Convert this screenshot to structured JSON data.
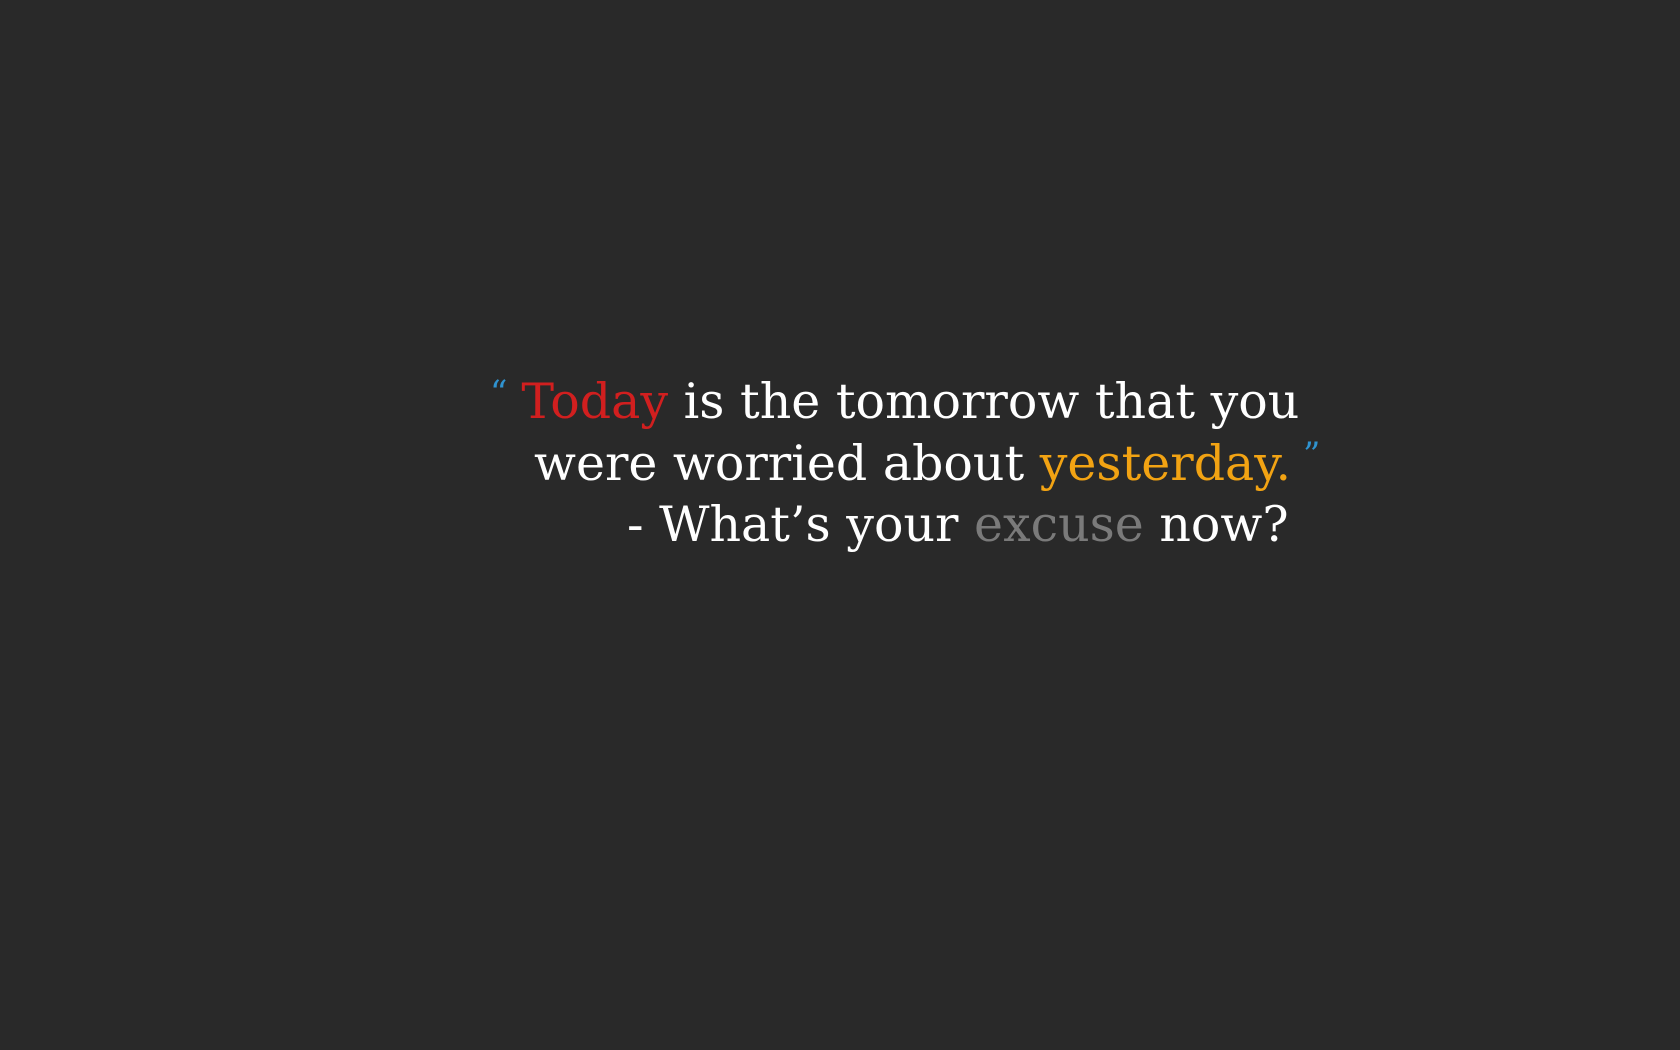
{
  "colors": {
    "background": "#292929",
    "text": "#ffffff",
    "quote_marks": "#2f93d0",
    "today": "#d11f1f",
    "yesterday": "#f2a313",
    "excuse": "#7a7a7a"
  },
  "quote": {
    "open_mark": "“",
    "line1": {
      "highlight": "Today",
      "rest": " is the tomorrow that you"
    },
    "line2": {
      "lead": "were worried about ",
      "highlight": "yesterday."
    },
    "close_mark": "”",
    "line3": {
      "lead": "- What’s your ",
      "highlight": "excuse",
      "tail": " now?"
    }
  }
}
